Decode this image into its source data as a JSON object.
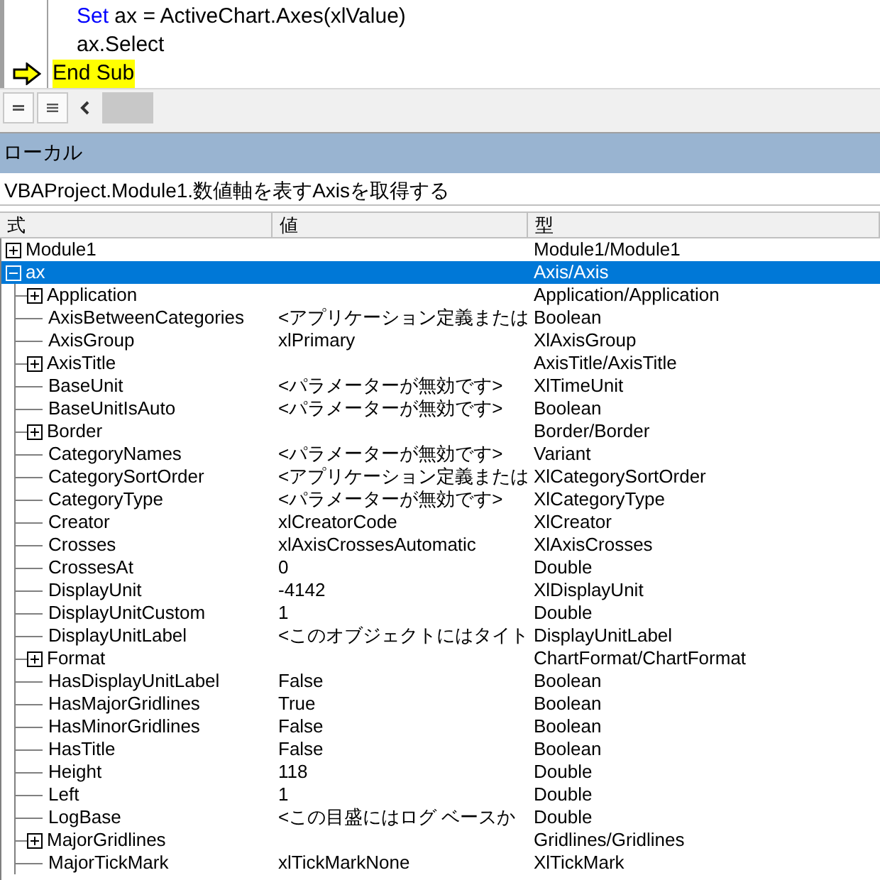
{
  "code": {
    "lines": [
      {
        "indent": true,
        "current": false,
        "segments": [
          {
            "text": "Set",
            "keyword": true
          },
          {
            "text": " ax = ActiveChart.Axes(xlValue)",
            "keyword": false
          }
        ]
      },
      {
        "indent": true,
        "current": false,
        "segments": [
          {
            "text": "ax.Select",
            "keyword": false
          }
        ]
      },
      {
        "indent": false,
        "current": true,
        "segments": [
          {
            "text": "End Sub",
            "keyword": false
          }
        ]
      }
    ]
  },
  "locals": {
    "title": "ローカル",
    "context": "VBAProject.Module1.数値軸を表すAxisを取得する",
    "columns": [
      "式",
      "値",
      "型"
    ],
    "rows": [
      {
        "name": "Module1",
        "type": "Module1/Module1",
        "kind": "object",
        "expanded": false,
        "selected": false
      },
      {
        "name": "ax",
        "type": "Axis/Axis",
        "kind": "object",
        "expanded": true,
        "selected": true,
        "children": [
          {
            "name": "Application",
            "type": "Application/Application",
            "kind": "object",
            "expanded": false,
            "selected": false
          },
          {
            "name": "AxisBetweenCategories",
            "value": "<アプリケーション定義または",
            "type": "Boolean",
            "kind": "property",
            "selected": false
          },
          {
            "name": "AxisGroup",
            "value": "xlPrimary",
            "type": "XlAxisGroup",
            "kind": "property",
            "selected": false
          },
          {
            "name": "AxisTitle",
            "type": "AxisTitle/AxisTitle",
            "kind": "object",
            "expanded": false,
            "selected": false
          },
          {
            "name": "BaseUnit",
            "value": "<パラメーターが無効です>",
            "type": "XlTimeUnit",
            "kind": "property",
            "selected": false
          },
          {
            "name": "BaseUnitIsAuto",
            "value": "<パラメーターが無効です>",
            "type": "Boolean",
            "kind": "property",
            "selected": false
          },
          {
            "name": "Border",
            "type": "Border/Border",
            "kind": "object",
            "expanded": false,
            "selected": false
          },
          {
            "name": "CategoryNames",
            "value": "<パラメーターが無効です>",
            "type": "Variant",
            "kind": "property",
            "selected": false
          },
          {
            "name": "CategorySortOrder",
            "value": "<アプリケーション定義または",
            "type": "XlCategorySortOrder",
            "kind": "property",
            "selected": false
          },
          {
            "name": "CategoryType",
            "value": "<パラメーターが無効です>",
            "type": "XlCategoryType",
            "kind": "property",
            "selected": false
          },
          {
            "name": "Creator",
            "value": "xlCreatorCode",
            "type": "XlCreator",
            "kind": "property",
            "selected": false
          },
          {
            "name": "Crosses",
            "value": "xlAxisCrossesAutomatic",
            "type": "XlAxisCrosses",
            "kind": "property",
            "selected": false
          },
          {
            "name": "CrossesAt",
            "value": "0",
            "type": "Double",
            "kind": "property",
            "selected": false
          },
          {
            "name": "DisplayUnit",
            "value": "-4142",
            "type": "XlDisplayUnit",
            "kind": "property",
            "selected": false
          },
          {
            "name": "DisplayUnitCustom",
            "value": "1",
            "type": "Double",
            "kind": "property",
            "selected": false
          },
          {
            "name": "DisplayUnitLabel",
            "value": "<このオブジェクトにはタイト",
            "type": "DisplayUnitLabel",
            "kind": "property",
            "selected": false
          },
          {
            "name": "Format",
            "type": "ChartFormat/ChartFormat",
            "kind": "object",
            "expanded": false,
            "selected": false
          },
          {
            "name": "HasDisplayUnitLabel",
            "value": "False",
            "type": "Boolean",
            "kind": "property",
            "selected": false
          },
          {
            "name": "HasMajorGridlines",
            "value": "True",
            "type": "Boolean",
            "kind": "property",
            "selected": false
          },
          {
            "name": "HasMinorGridlines",
            "value": "False",
            "type": "Boolean",
            "kind": "property",
            "selected": false
          },
          {
            "name": "HasTitle",
            "value": "False",
            "type": "Boolean",
            "kind": "property",
            "selected": false
          },
          {
            "name": "Height",
            "value": "118",
            "type": "Double",
            "kind": "property",
            "selected": false
          },
          {
            "name": "Left",
            "value": "1",
            "type": "Double",
            "kind": "property",
            "selected": false
          },
          {
            "name": "LogBase",
            "value": "<この目盛にはログ ベースか",
            "type": "Double",
            "kind": "property",
            "selected": false
          },
          {
            "name": "MajorGridlines",
            "type": "Gridlines/Gridlines",
            "kind": "object",
            "expanded": false,
            "selected": false
          },
          {
            "name": "MajorTickMark",
            "value": "xlTickMarkNone",
            "type": "XlTickMark",
            "kind": "property",
            "selected": false
          }
        ]
      }
    ]
  }
}
